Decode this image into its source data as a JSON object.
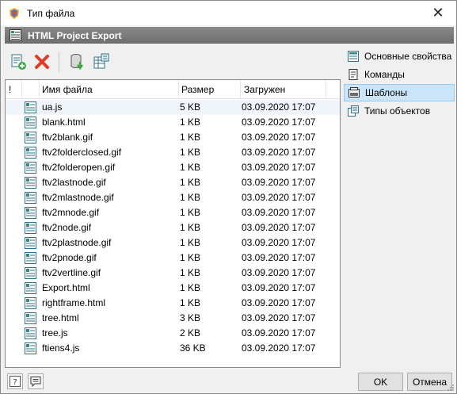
{
  "window": {
    "title": "Тип файла",
    "close_glyph": "✕"
  },
  "header": {
    "title": "HTML Project Export",
    "icon": "grid-form-icon"
  },
  "toolbar": {
    "buttons": [
      {
        "name": "add-file-icon"
      },
      {
        "name": "delete-icon"
      },
      {
        "name": "import-database-icon"
      },
      {
        "name": "export-grid-icon"
      }
    ]
  },
  "list": {
    "columns": {
      "flag": "!",
      "name": "Имя файла",
      "size": "Размер",
      "loaded": "Загружен"
    },
    "rows": [
      {
        "name": "ua.js",
        "size": "5 KB",
        "date": "03.09.2020 17:07"
      },
      {
        "name": "blank.html",
        "size": "1 KB",
        "date": "03.09.2020 17:07"
      },
      {
        "name": "ftv2blank.gif",
        "size": "1 KB",
        "date": "03.09.2020 17:07"
      },
      {
        "name": "ftv2folderclosed.gif",
        "size": "1 KB",
        "date": "03.09.2020 17:07"
      },
      {
        "name": "ftv2folderopen.gif",
        "size": "1 KB",
        "date": "03.09.2020 17:07"
      },
      {
        "name": "ftv2lastnode.gif",
        "size": "1 KB",
        "date": "03.09.2020 17:07"
      },
      {
        "name": "ftv2mlastnode.gif",
        "size": "1 KB",
        "date": "03.09.2020 17:07"
      },
      {
        "name": "ftv2mnode.gif",
        "size": "1 KB",
        "date": "03.09.2020 17:07"
      },
      {
        "name": "ftv2node.gif",
        "size": "1 KB",
        "date": "03.09.2020 17:07"
      },
      {
        "name": "ftv2plastnode.gif",
        "size": "1 KB",
        "date": "03.09.2020 17:07"
      },
      {
        "name": "ftv2pnode.gif",
        "size": "1 KB",
        "date": "03.09.2020 17:07"
      },
      {
        "name": "ftv2vertline.gif",
        "size": "1 KB",
        "date": "03.09.2020 17:07"
      },
      {
        "name": "Export.html",
        "size": "1 KB",
        "date": "03.09.2020 17:07"
      },
      {
        "name": "rightframe.html",
        "size": "1 KB",
        "date": "03.09.2020 17:07"
      },
      {
        "name": "tree.html",
        "size": "3 KB",
        "date": "03.09.2020 17:07"
      },
      {
        "name": "tree.js",
        "size": "2 KB",
        "date": "03.09.2020 17:07"
      },
      {
        "name": "ftiens4.js",
        "size": "36 KB",
        "date": "03.09.2020 17:07"
      }
    ]
  },
  "sidebar": {
    "items": [
      {
        "label": "Основные свойства",
        "icon": "properties-icon"
      },
      {
        "label": "Команды",
        "icon": "commands-icon"
      },
      {
        "label": "Шаблоны",
        "icon": "templates-icon",
        "active": true
      },
      {
        "label": "Типы объектов",
        "icon": "object-types-icon"
      }
    ]
  },
  "footer": {
    "ok_label": "OK",
    "cancel_label": "Отмена"
  },
  "colors": {
    "accent_selected": "#cce4f7",
    "header_bar": "#7a7a7a",
    "delete_red": "#e03b24",
    "icon_teal": "#2f8a8a"
  }
}
